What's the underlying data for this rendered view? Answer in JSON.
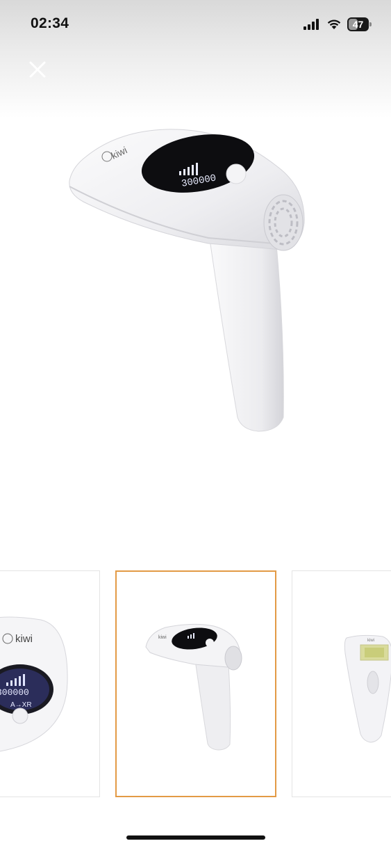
{
  "status_bar": {
    "time": "02:34",
    "battery_level": "47",
    "battery_fraction": 0.47
  },
  "header": {
    "close_icon": "close-icon"
  },
  "product": {
    "brand": "kiwi",
    "display_digits": "300000",
    "display_mode": "A→XR"
  },
  "gallery": {
    "selected_index": 1,
    "accent_color": "#e39a45",
    "thumbnails": [
      {
        "name": "front-view"
      },
      {
        "name": "angled-view"
      },
      {
        "name": "top-view"
      }
    ]
  }
}
